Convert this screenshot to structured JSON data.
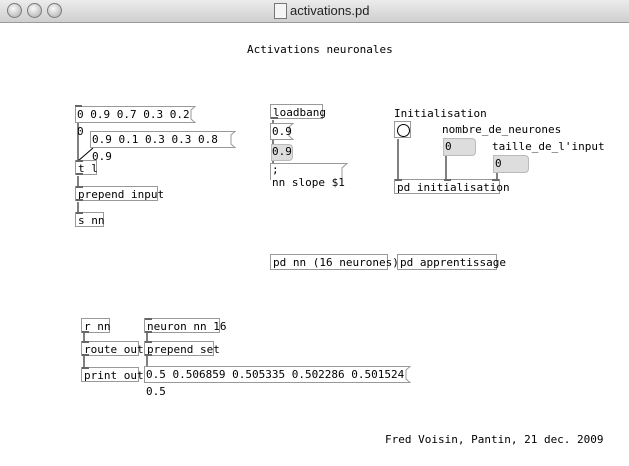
{
  "window": {
    "title": "activations.pd"
  },
  "patch": {
    "title": "Activations neuronales",
    "credit": "Fred Voisin, Pantin, 21 dec. 2009",
    "msg_list1": "0 0.9 0.7 0.3 0.2 0",
    "msg_list2": "0.9 0.1 0.3 0.3 0.8 0.9",
    "obj_trigger": "t l",
    "obj_prepend_input": "prepend input",
    "obj_send_nn": "s nn",
    "obj_loadbang": "loadbang",
    "msg_09": "0.9",
    "atom_09": "0.9",
    "msg_slope": ";\nnn slope $1",
    "comment_initialisation": "Initialisation",
    "comment_nombre": "nombre_de_neurones",
    "comment_taille": "taille_de_l'input",
    "atom_nombre": "0",
    "atom_taille": "0",
    "obj_pd_init": "pd initialisation",
    "obj_pd_nn": "pd nn (16 neurones)",
    "obj_pd_apprentissage": "pd apprentissage",
    "obj_r_nn": "r nn",
    "obj_route_out": "route out",
    "obj_print_out": "print out",
    "obj_neuron": "neuron nn 16",
    "obj_prepend_set": "prepend set",
    "msg_output": "0.5 0.506859 0.505335 0.502286 0.501524 0.5"
  }
}
